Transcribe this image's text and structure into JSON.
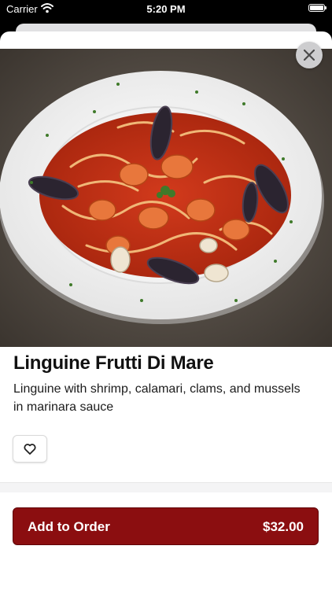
{
  "status_bar": {
    "carrier": "Carrier",
    "time": "5:20 PM"
  },
  "item": {
    "name": "Linguine Frutti Di Mare",
    "description": "Linguine with shrimp, calamari, clams, and mussels in marinara sauce"
  },
  "order_button": {
    "label": "Add to Order",
    "price": "$32.00"
  },
  "colors": {
    "accent": "#8b0e10",
    "sheet_background": "#ffffff"
  },
  "icons": {
    "close": "close-icon",
    "favorite": "heart-icon",
    "wifi": "wifi-icon",
    "battery": "battery-icon"
  }
}
